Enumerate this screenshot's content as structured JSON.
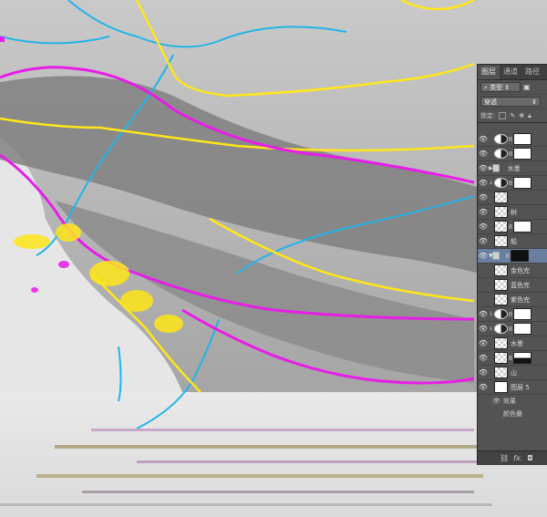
{
  "panel": {
    "tabs": [
      "图层",
      "通道",
      "路径"
    ],
    "filter_label": "类型",
    "blend_mode": "穿透",
    "lock_label": "锁定:"
  },
  "layers": {
    "group_water": "水墨",
    "shape1": "",
    "tree": "树",
    "boat": "船",
    "sub_gold": "金色完",
    "sub_blue": "蓝色完",
    "sub_purple": "紫色完",
    "water2": "水墨",
    "mountain": "山",
    "layer5": "图层 5",
    "effects": "效果",
    "color_overlay": "颜色叠"
  },
  "colors": {
    "magenta": "#e81de8",
    "yellow": "#ffe619",
    "cyan": "#22b4e8",
    "panel_bg": "#535353",
    "selected": "#6a7fa0"
  }
}
